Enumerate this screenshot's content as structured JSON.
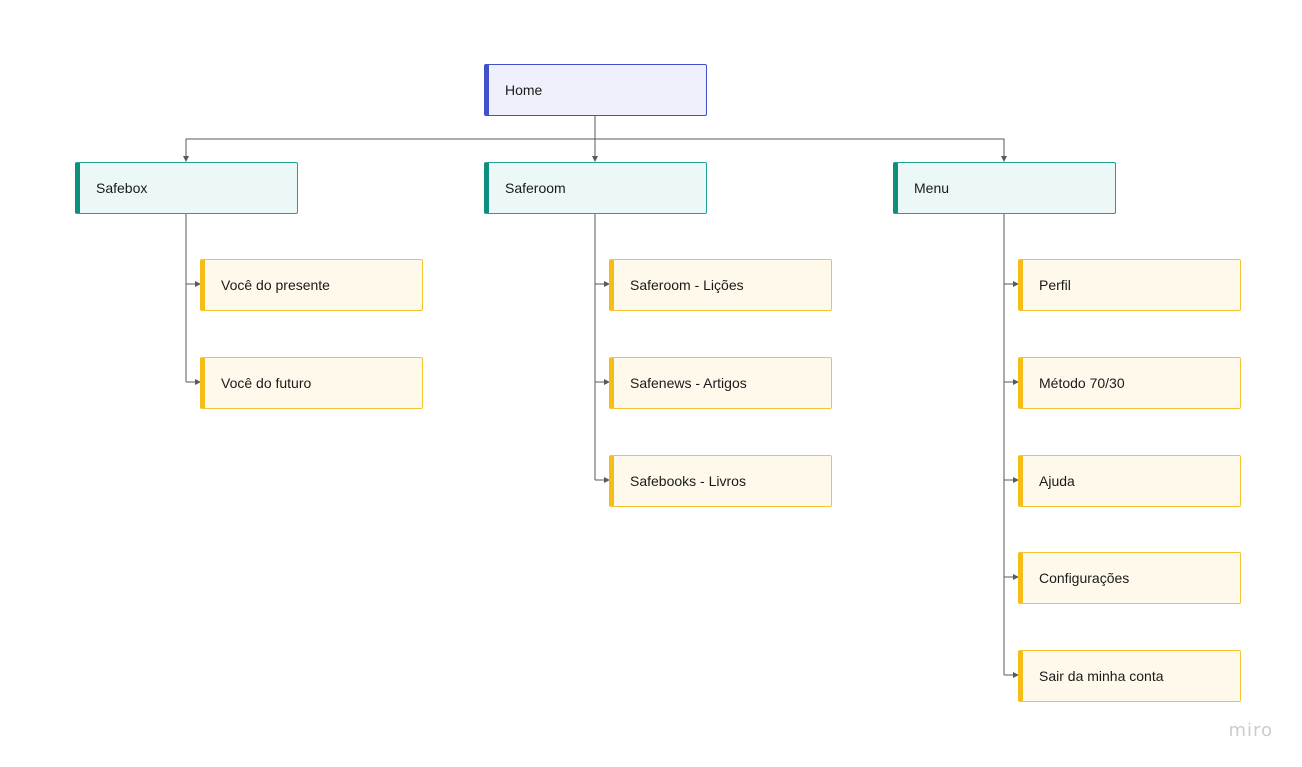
{
  "diagram": {
    "root": {
      "label": "Home"
    },
    "sections": [
      {
        "label": "Safebox",
        "children": [
          "Você do presente",
          "Você do futuro"
        ]
      },
      {
        "label": "Saferoom",
        "children": [
          "Saferoom - Lições",
          "Safenews - Artigos",
          "Safebooks - Livros"
        ]
      },
      {
        "label": "Menu",
        "children": [
          "Perfil",
          "Método 70/30",
          "Ajuda",
          "Configurações",
          "Sair da minha conta"
        ]
      }
    ]
  },
  "watermark": "miro",
  "colors": {
    "root_accent": "#4051c9",
    "section_accent": "#0e8f7e",
    "page_accent": "#f6bd16",
    "connector": "#5a5a5a"
  }
}
